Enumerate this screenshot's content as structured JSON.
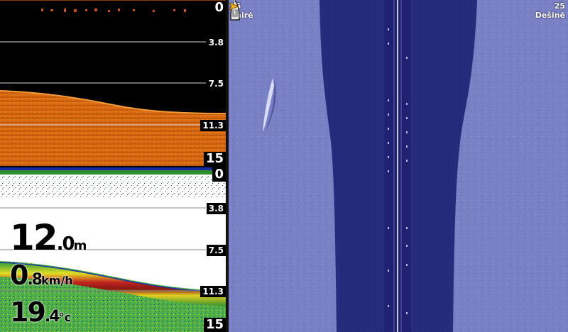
{
  "sonar_top": {
    "depth_scale": [
      "0",
      "3.8",
      "7.5",
      "11.3",
      "15"
    ],
    "colors": {
      "bottom": "#d86a14",
      "background": "#000000"
    }
  },
  "sonar_bottom": {
    "depth_scale": [
      "0",
      "3.8",
      "7.5",
      "11.3",
      "15"
    ],
    "depth": {
      "value_int": "12",
      "value_dec": ".0",
      "unit": "m"
    },
    "speed": {
      "value_int": "0",
      "value_dec": ".8",
      "unit": "km/h"
    },
    "temperature": {
      "value_int": "19",
      "value_dec": ".4",
      "unit": "°c"
    },
    "colors": {
      "background": "#ffffff",
      "bottom_top": "#2e8f2e",
      "bottom_band": "#c81e1e"
    }
  },
  "side_imaging": {
    "left_label": {
      "range": "25",
      "side": "Kairė"
    },
    "right_label": {
      "range": "25",
      "side": "Dešinė"
    },
    "colors": {
      "seabed": "#7a80c4",
      "water_column": "#262a7a",
      "center_line": "#ffffff"
    },
    "icons": {
      "boat": "boat-icon",
      "cursor": "cursor-arrow-icon"
    }
  }
}
